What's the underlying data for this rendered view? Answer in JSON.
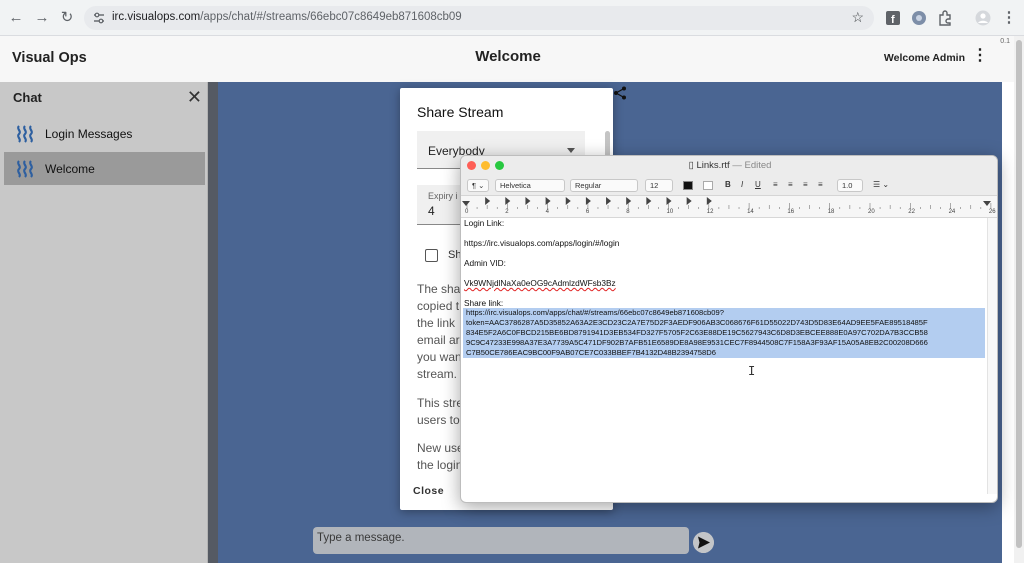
{
  "browser": {
    "back_icon": "arrow-left-icon",
    "forward_icon": "arrow-right-icon",
    "reload_icon": "reload-icon",
    "url_host": "irc.visualops.com",
    "url_path": "/apps/chat/#/streams/66ebc07c8649eb871608cb09",
    "bookmark_icon": "star-icon"
  },
  "app": {
    "title": "Visual Ops",
    "page_title": "Welcome",
    "user_greeting": "Welcome Admin",
    "version": "0.1"
  },
  "sidebar": {
    "title": "Chat",
    "items": [
      {
        "label": "Login Messages",
        "active": false
      },
      {
        "label": "Welcome",
        "active": true
      }
    ]
  },
  "chat": {
    "message_placeholder": "Type a message."
  },
  "share_dialog": {
    "title": "Share Stream",
    "audience_value": "Everybody",
    "expiry_label": "Expiry i",
    "expiry_value": "4",
    "checkbox_label": "Sh",
    "paragraph1": [
      "The sha",
      "copied t",
      "the link",
      "email ar",
      "you wan",
      "stream."
    ],
    "paragraph2": [
      "This stre",
      "users to"
    ],
    "paragraph3": [
      "New use",
      "the login"
    ],
    "close_label": "Close"
  },
  "textedit": {
    "filename": "Links.rtf",
    "status": "Edited",
    "toolbar": {
      "paragraph": "¶",
      "font": "Helvetica",
      "style": "Regular",
      "size": "12",
      "bold": "B",
      "italic": "I",
      "underline": "U",
      "spacing": "1.0"
    },
    "ruler_numbers": [
      "0",
      "2",
      "4",
      "6",
      "8",
      "10",
      "12",
      "14",
      "16",
      "18",
      "20",
      "22",
      "24",
      "26"
    ],
    "lines": {
      "login_label": "Login Link:",
      "login_url": "https://irc.visualops.com/apps/login/#/login",
      "admin_label": "Admin VID:",
      "admin_vid": "Vk9WNjdlNaXa0eOG9cAdmlzdWFsb3Bz",
      "share_label": "Share link:"
    },
    "share_link_lines": [
      "https://irc.visualops.com/apps/chat/#/streams/66ebc07c8649eb871608cb09?",
      "token=AAC3786287A5D35852A63A2E3CD23C2A7E75D2F3AEDF906AB3C068676F61D55022D743D5D83E64AD9EE5FAE89518485F",
      "834E5F2A6C0FBCD215BE6BD8791941D3EB534FD327F5705F2C63E88DE19C5627943C6D8D3EBCEE888E0A97C702DA7B3CCB58",
      "9C9C47233E998A37E3A7739A5C471DF902B7AFB51E6589DE8A98E9531CEC7F8944508C7F158A3F93AF15A05A8EB2C00208D666",
      "C7B50CE786EAC9BC00F9AB07CE7C033BBEF7B4132D48B2394758D6"
    ]
  }
}
